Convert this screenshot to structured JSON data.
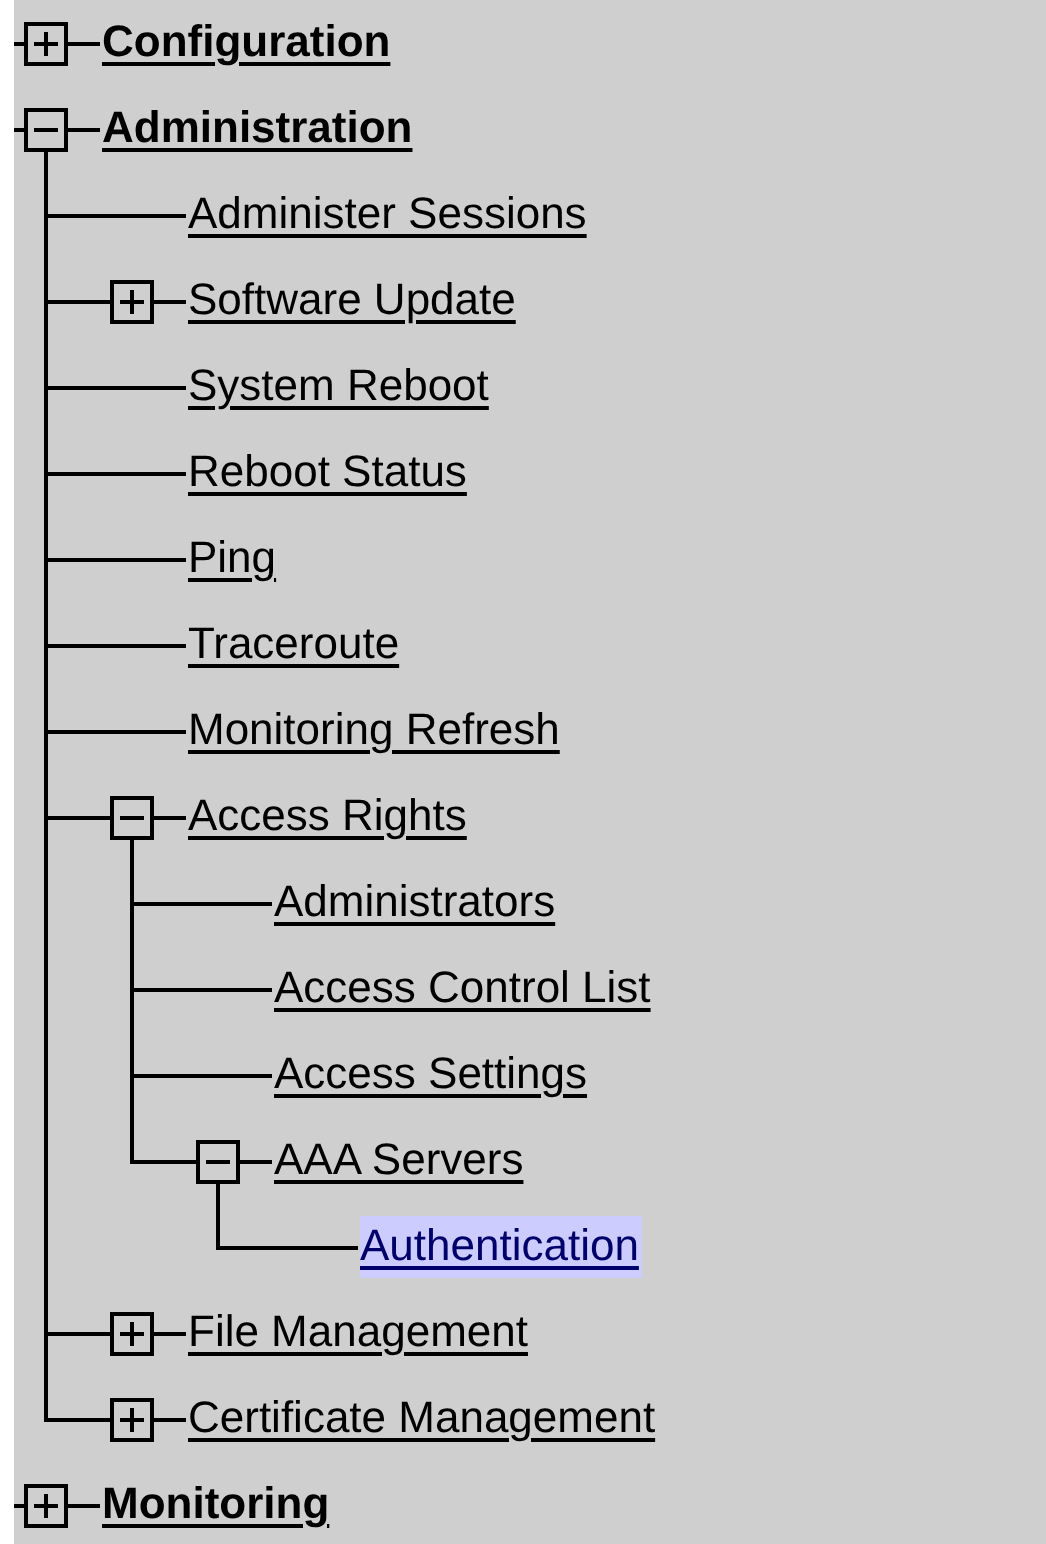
{
  "tree": [
    {
      "label": "Configuration",
      "expanded": false,
      "selected": false
    },
    {
      "label": "Administration",
      "expanded": true,
      "selected": false,
      "children": [
        {
          "label": "Administer Sessions",
          "selected": false
        },
        {
          "label": "Software Update",
          "expanded": false,
          "selected": false
        },
        {
          "label": "System Reboot",
          "selected": false
        },
        {
          "label": "Reboot Status",
          "selected": false
        },
        {
          "label": "Ping",
          "selected": false
        },
        {
          "label": "Traceroute",
          "selected": false
        },
        {
          "label": "Monitoring Refresh",
          "selected": false
        },
        {
          "label": "Access Rights",
          "expanded": true,
          "selected": false,
          "children": [
            {
              "label": "Administrators",
              "selected": false
            },
            {
              "label": "Access Control List",
              "selected": false
            },
            {
              "label": "Access Settings",
              "selected": false
            },
            {
              "label": "AAA Servers",
              "expanded": true,
              "selected": false,
              "children": [
                {
                  "label": "Authentication",
                  "selected": true
                }
              ]
            }
          ]
        },
        {
          "label": "File Management",
          "expanded": false,
          "selected": false
        },
        {
          "label": "Certificate Management",
          "expanded": false,
          "selected": false
        }
      ]
    },
    {
      "label": "Monitoring",
      "expanded": false,
      "selected": false
    }
  ]
}
